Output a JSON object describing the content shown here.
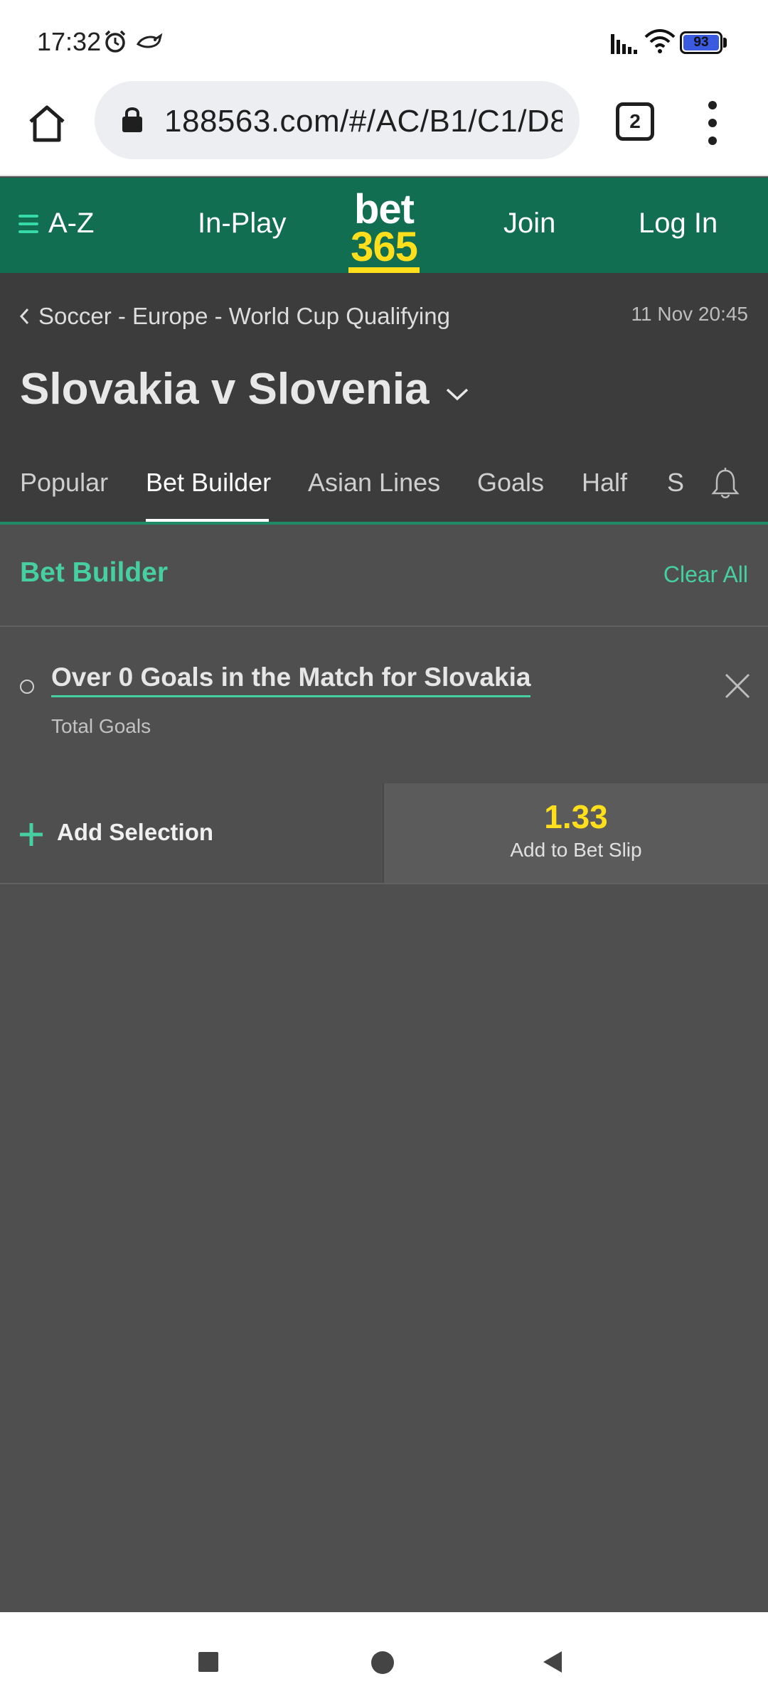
{
  "status": {
    "time": "17:32",
    "battery": "93",
    "icons": [
      "alarm-icon",
      "bird-icon",
      "signal-icon",
      "wifi-icon",
      "battery-icon"
    ]
  },
  "browser": {
    "url": "188563.com/#/AC/B1/C1/D8",
    "tab_count": "2",
    "icons": [
      "home-icon",
      "lock-icon",
      "more-vert-icon"
    ]
  },
  "header": {
    "az_label": "A-Z",
    "inplay_label": "In-Play",
    "logo_top": "bet",
    "logo_bottom": "365",
    "join_label": "Join",
    "login_label": "Log In",
    "brand_green": "#126e51",
    "brand_yellow": "#ffdf1b"
  },
  "match": {
    "breadcrumb": "Soccer - Europe - World Cup Qualifying",
    "datetime": "11 Nov 20:45",
    "title": "Slovakia v Slovenia"
  },
  "tabs": [
    {
      "label": "Popular",
      "active": false
    },
    {
      "label": "Bet Builder",
      "active": true
    },
    {
      "label": "Asian Lines",
      "active": false
    },
    {
      "label": "Goals",
      "active": false
    },
    {
      "label": "Half",
      "active": false
    },
    {
      "label": "S",
      "active": false
    }
  ],
  "bet_builder": {
    "heading": "Bet Builder",
    "clear_all": "Clear All",
    "selection": {
      "title": "Over 0 Goals in the Match for Slovakia",
      "market": "Total Goals"
    },
    "add_selection": "Add Selection",
    "odds": "1.33",
    "add_to_slip": "Add to Bet Slip",
    "accent": "#46cfa0"
  }
}
